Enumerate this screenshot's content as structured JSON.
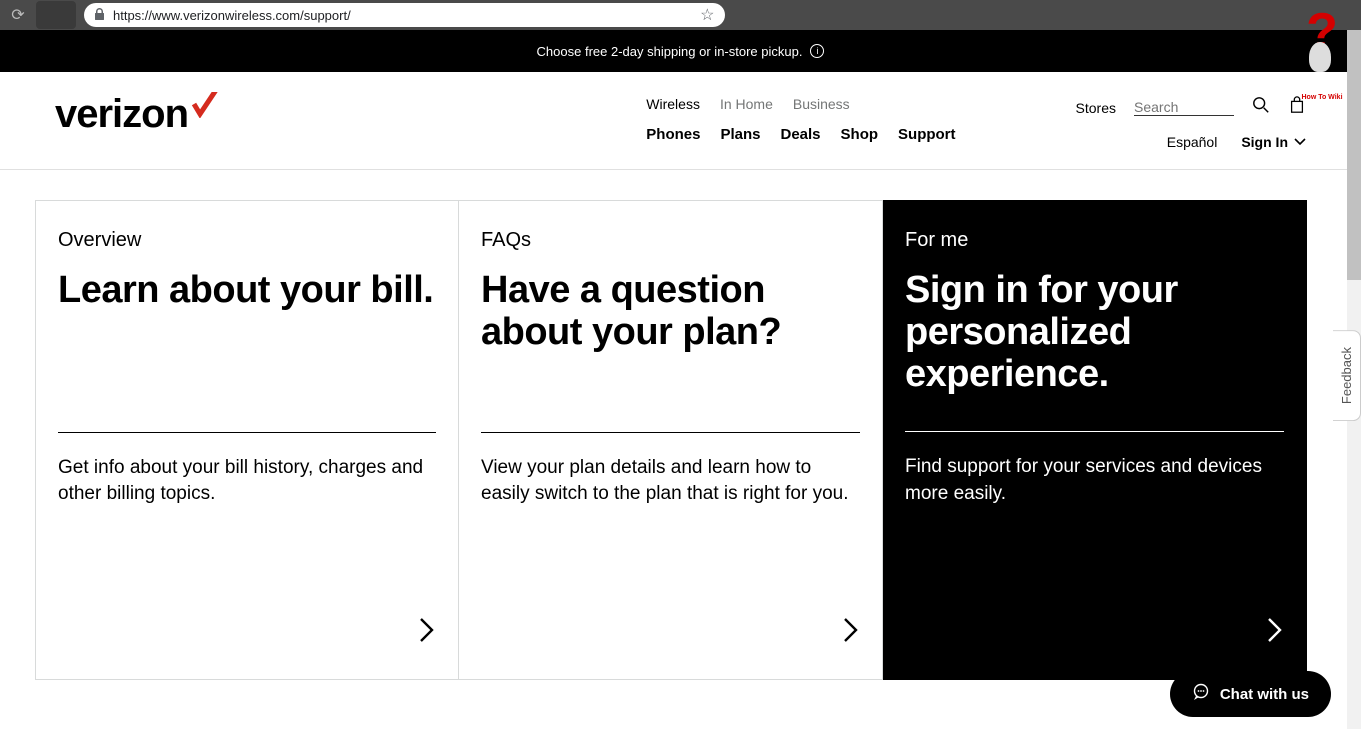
{
  "browser": {
    "url": "https://www.verizonwireless.com/support/"
  },
  "promo": {
    "text": "Choose free 2-day shipping or in-store pickup."
  },
  "logo": {
    "text": "verizon"
  },
  "nav_top": {
    "wireless": "Wireless",
    "inhome": "In Home",
    "business": "Business"
  },
  "nav_bottom": {
    "phones": "Phones",
    "plans": "Plans",
    "deals": "Deals",
    "shop": "Shop",
    "support": "Support"
  },
  "util": {
    "stores": "Stores",
    "search_placeholder": "Search",
    "espanol": "Español",
    "signin": "Sign In"
  },
  "cards": {
    "overview": {
      "eyebrow": "Overview",
      "title": "Learn about your bill.",
      "body": "Get info about your bill history, charges and other billing topics."
    },
    "faqs": {
      "eyebrow": "FAQs",
      "title": "Have a question about your plan?",
      "body": "View your plan details and learn how to easily switch to the plan that is right for you."
    },
    "forme": {
      "eyebrow": "For me",
      "title": "Sign in for your personalized experience.",
      "body": "Find support for your services and devices more easily."
    }
  },
  "feedback": {
    "label": "Feedback"
  },
  "chat": {
    "label": "Chat with us"
  },
  "watermark": {
    "label": "How To Wiki"
  }
}
